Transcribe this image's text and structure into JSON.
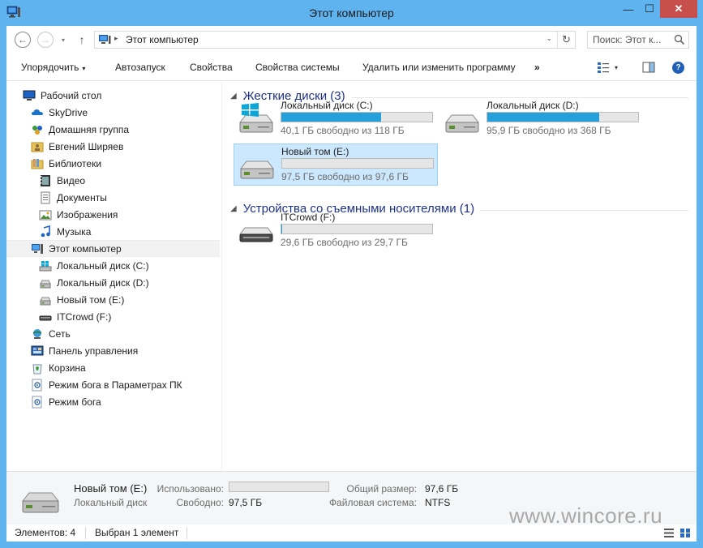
{
  "window": {
    "title": "Этот компьютер",
    "minimize_glyph": "—",
    "maximize_glyph": "☐",
    "close_glyph": "✕"
  },
  "nav": {
    "back_glyph": "←",
    "forward_glyph": "→",
    "history_glyph": "▾",
    "up_glyph": "↑",
    "address_separator": "▸",
    "address_path": "Этот компьютер",
    "address_dropdown_glyph": "⌄",
    "refresh_glyph": "↻",
    "search_placeholder": "Поиск: Этот к..."
  },
  "toolbar": {
    "organize": "Упорядочить",
    "autoplay": "Автозапуск",
    "properties": "Свойства",
    "system_properties": "Свойства системы",
    "uninstall": "Удалить или изменить программу",
    "more": "»",
    "view_caret": "▾",
    "help_glyph": "?"
  },
  "navpane": {
    "items": [
      {
        "label": "Рабочий стол",
        "icon": "desktop-icon"
      },
      {
        "label": "SkyDrive",
        "icon": "skydrive-icon"
      },
      {
        "label": "Домашняя группа",
        "icon": "homegroup-icon"
      },
      {
        "label": "Евгений Ширяев",
        "icon": "user-folder-icon"
      },
      {
        "label": "Библиотеки",
        "icon": "libraries-icon"
      },
      {
        "label": "Видео",
        "icon": "video-icon"
      },
      {
        "label": "Документы",
        "icon": "documents-icon"
      },
      {
        "label": "Изображения",
        "icon": "pictures-icon"
      },
      {
        "label": "Музыка",
        "icon": "music-icon"
      },
      {
        "label": "Этот компьютер",
        "icon": "computer-icon",
        "selected": true
      },
      {
        "label": "Локальный диск (C:)",
        "icon": "system-drive-icon"
      },
      {
        "label": "Локальный диск (D:)",
        "icon": "drive-icon"
      },
      {
        "label": "Новый том (E:)",
        "icon": "drive-icon"
      },
      {
        "label": "ITCrowd (F:)",
        "icon": "removable-drive-icon"
      },
      {
        "label": "Сеть",
        "icon": "network-icon"
      },
      {
        "label": "Панель управления",
        "icon": "control-panel-icon"
      },
      {
        "label": "Корзина",
        "icon": "recycle-bin-icon"
      },
      {
        "label": "Режим бога в Параметрах ПК",
        "icon": "godmode-icon"
      },
      {
        "label": "Режим бога",
        "icon": "godmode-icon"
      }
    ]
  },
  "content": {
    "group_chevron": "◢",
    "hard_drives": {
      "heading": "Жесткие диски (3)",
      "drives": [
        {
          "name": "Локальный диск (C:)",
          "free_text": "40,1 ГБ свободно из 118 ГБ",
          "used_fraction": 0.66,
          "icon": "system-drive-icon"
        },
        {
          "name": "Локальный диск (D:)",
          "free_text": "95,9 ГБ свободно из 368 ГБ",
          "used_fraction": 0.74,
          "icon": "drive-icon"
        },
        {
          "name": "Новый том (E:)",
          "free_text": "97,5 ГБ свободно из 97,6 ГБ",
          "used_fraction": 0.001,
          "icon": "drive-icon",
          "selected": true
        }
      ]
    },
    "removable": {
      "heading": "Устройства со съемными носителями (1)",
      "drives": [
        {
          "name": "ITCrowd (F:)",
          "free_text": "29,6 ГБ свободно из 29,7 ГБ",
          "used_fraction": 0.003,
          "icon": "removable-drive-icon"
        }
      ]
    }
  },
  "details": {
    "name": "Новый том (E:)",
    "type": "Локальный диск",
    "used_label": "Использовано:",
    "used_fraction": 0.001,
    "free_label": "Свободно:",
    "free_value": "97,5 ГБ",
    "total_label": "Общий размер:",
    "total_value": "97,6 ГБ",
    "fs_label": "Файловая система:",
    "fs_value": "NTFS"
  },
  "status": {
    "items_count": "Элементов: 4",
    "selected": "Выбран 1 элемент",
    "watermark": "www.wincore.ru"
  },
  "colors": {
    "titlebar": "#5fb4f0",
    "close": "#c7504c",
    "progress": "#26a0da",
    "selection": "#cce8ff",
    "group_heading": "#1e3287"
  }
}
